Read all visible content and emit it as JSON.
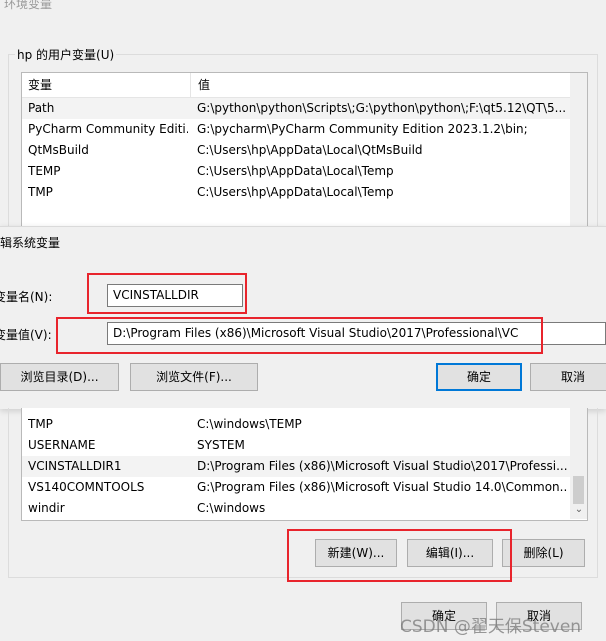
{
  "title": "环境变量",
  "user_vars": {
    "group_label": "hp 的用户变量(U)",
    "col_variable": "变量",
    "col_value": "值",
    "rows": [
      {
        "name": "Path",
        "value": "G:\\python\\python\\Scripts\\;G:\\python\\python\\;F:\\qt5.12\\QT\\5...."
      },
      {
        "name": "PyCharm Community Editi...",
        "value": "G:\\pycharm\\PyCharm Community Edition 2023.1.2\\bin;"
      },
      {
        "name": "QtMsBuild",
        "value": "C:\\Users\\hp\\AppData\\Local\\QtMsBuild"
      },
      {
        "name": "TEMP",
        "value": "C:\\Users\\hp\\AppData\\Local\\Temp"
      },
      {
        "name": "TMP",
        "value": "C:\\Users\\hp\\AppData\\Local\\Temp"
      }
    ]
  },
  "edit_dialog": {
    "title": "辑系统变量",
    "name_label": "变量名(N):",
    "name_value": "VCINSTALLDIR",
    "value_label": "变量值(V):",
    "value_value": "D:\\Program Files (x86)\\Microsoft Visual Studio\\2017\\Professional\\VC",
    "browse_dir": "浏览目录(D)...",
    "browse_file": "浏览文件(F)...",
    "ok": "确定",
    "cancel": "取消"
  },
  "system_vars": {
    "rows": [
      {
        "name": "TMP",
        "value": "C:\\windows\\TEMP"
      },
      {
        "name": "USERNAME",
        "value": "SYSTEM"
      },
      {
        "name": "VCINSTALLDIR1",
        "value": "D:\\Program Files (x86)\\Microsoft Visual Studio\\2017\\Professi..."
      },
      {
        "name": "VS140COMNTOOLS",
        "value": "G:\\Program Files (x86)\\Microsoft Visual Studio 14.0\\Common..."
      },
      {
        "name": "windir",
        "value": "C:\\windows"
      }
    ],
    "new": "新建(W)...",
    "edit": "编辑(I)...",
    "delete": "删除(L)"
  },
  "footer": {
    "ok": "确定",
    "cancel": "取消"
  },
  "watermark": "CSDN @翟天保Steven",
  "colors": {
    "highlight": "#e8242c",
    "accent": "#0078d7"
  }
}
